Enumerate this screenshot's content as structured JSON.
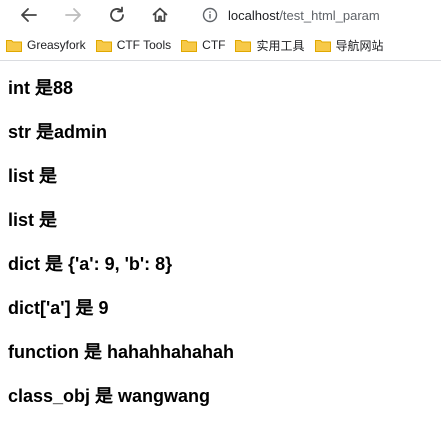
{
  "browser": {
    "url_host": "localhost",
    "url_path": "/test_html_param",
    "bookmarks": [
      {
        "label": "Greasyfork"
      },
      {
        "label": "CTF Tools"
      },
      {
        "label": "CTF"
      },
      {
        "label": "实用工具"
      },
      {
        "label": "导航网站"
      }
    ],
    "colors": {
      "folder": "#f7c948",
      "folder_dark": "#e0a800"
    },
    "icons": [
      "back-icon",
      "forward-icon",
      "reload-icon",
      "home-icon",
      "info-icon",
      "folder-icon"
    ]
  },
  "page": {
    "lines": [
      "int 是88",
      "str 是admin",
      "list 是",
      "list 是",
      "dict 是 {'a': 9, 'b': 8}",
      "dict['a'] 是 9",
      "function 是 hahahhahahah",
      "class_obj 是 wangwang"
    ]
  }
}
